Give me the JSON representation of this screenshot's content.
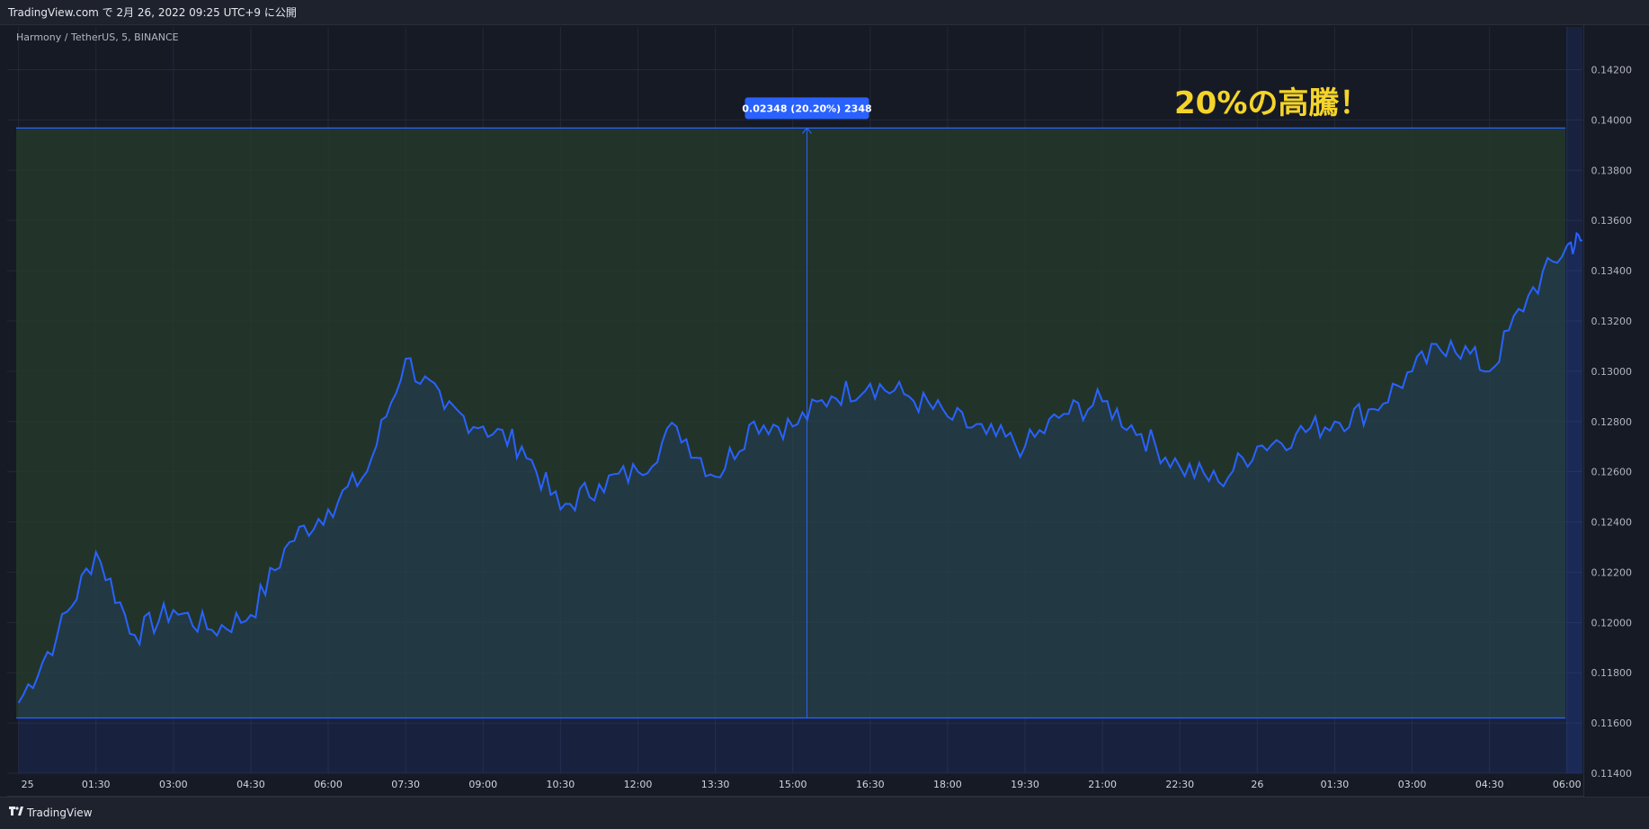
{
  "header": {
    "published": "TradingView.com で 2月 26, 2022 09:25 UTC+9 に公開"
  },
  "symbol": {
    "title": "Harmony / TetherUS, 5, BINANCE"
  },
  "annotation": {
    "text": "20%の高騰！"
  },
  "measure": {
    "label": "0.02348 (20.20%) 2348",
    "from": 0.1162,
    "to": 0.13968
  },
  "footer": {
    "brand": "TradingView"
  },
  "colors": {
    "line": "#2962ff",
    "measure_fill": "#243a2c",
    "annotation": "#f5d42a",
    "label_bg": "#2962ff"
  },
  "chart_data": {
    "type": "area",
    "x_ticks": [
      "25",
      "01:30",
      "03:00",
      "04:30",
      "06:00",
      "07:30",
      "09:00",
      "10:30",
      "12:00",
      "13:30",
      "15:00",
      "16:30",
      "18:00",
      "19:30",
      "21:00",
      "22:30",
      "26",
      "01:30",
      "03:00",
      "04:30",
      "06:00"
    ],
    "y_ticks": [
      "0.14200",
      "0.14000",
      "0.13800",
      "0.13600",
      "0.13400",
      "0.13200",
      "0.13000",
      "0.12800",
      "0.12600",
      "0.12400",
      "0.12200",
      "0.12000",
      "0.11800",
      "0.11600",
      "0.11400"
    ],
    "ylim": [
      0.114,
      0.1437
    ],
    "xlim": [
      -0.1,
      20.2
    ],
    "grid": true,
    "x": [
      0,
      0.5,
      1,
      1.5,
      2,
      2.5,
      3,
      3.5,
      4,
      4.5,
      5,
      5.5,
      6,
      6.5,
      7,
      7.5,
      8,
      8.5,
      9,
      9.5,
      10,
      10.5,
      11,
      11.5,
      12,
      12.5,
      13,
      13.5,
      14,
      14.5,
      15,
      15.5,
      16,
      16.5,
      17,
      17.5,
      18,
      18.5,
      19,
      19.5,
      20,
      20.2
    ],
    "values": [
      0.1168,
      0.1195,
      0.1228,
      0.1195,
      0.1205,
      0.1197,
      0.1203,
      0.1232,
      0.1245,
      0.126,
      0.1305,
      0.1285,
      0.1278,
      0.127,
      0.1245,
      0.1255,
      0.126,
      0.1278,
      0.1258,
      0.128,
      0.1278,
      0.129,
      0.1295,
      0.129,
      0.1282,
      0.1275,
      0.127,
      0.1283,
      0.1288,
      0.1275,
      0.1262,
      0.1256,
      0.127,
      0.1275,
      0.128,
      0.1285,
      0.13,
      0.1312,
      0.13,
      0.133,
      0.135,
      0.1352
    ]
  }
}
